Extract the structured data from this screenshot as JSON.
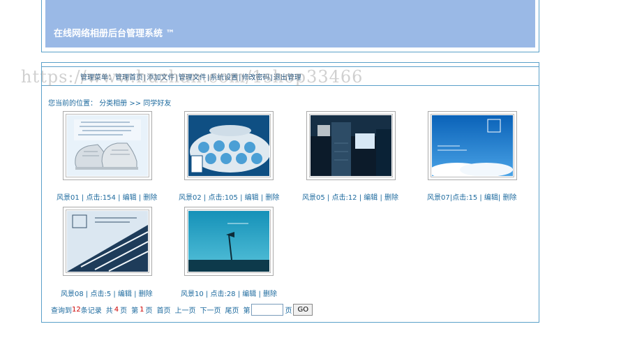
{
  "header": {
    "title": "在线网络相册后台管理系统 ™"
  },
  "nav": {
    "prefix": "管理菜单：",
    "items": [
      "管理首页",
      "添加文件",
      "管理文件",
      "系统设置",
      "修改密码",
      "退出管理"
    ],
    "separator": "|"
  },
  "watermark": "https://www.huzhan.com/1shop33466",
  "breadcrumb": {
    "label": "您当前的位置：",
    "category": "分类相册",
    "arrow": ">>",
    "current": "同学好友"
  },
  "photos": [
    {
      "caption": "风景01 | 点击:154 | 编辑 | 删除"
    },
    {
      "caption": "风景02 | 点击:105 | 编辑 | 删除"
    },
    {
      "caption": "风景05 | 点击:12 | 编辑 | 删除"
    },
    {
      "caption": "风景07|点击:15 | 编辑| 删除"
    },
    {
      "caption": "风景08 | 点击:5 | 编辑 | 删除"
    },
    {
      "caption": "风景10 | 点击:28 | 编辑 | 删除"
    }
  ],
  "pager": {
    "found": "查询到",
    "total_records": "12",
    "records_unit": "条记录",
    "total_prefix": "共",
    "total_pages": "4",
    "page_unit": "页",
    "current_prefix": "第",
    "current_page": "1",
    "current_suffix": "页",
    "first": "首页",
    "prev": "上一页",
    "next": "下一页",
    "last": "尾页",
    "jump_prefix": "第",
    "jump_input_value": "",
    "jump_suffix": "页",
    "go": "GO"
  }
}
